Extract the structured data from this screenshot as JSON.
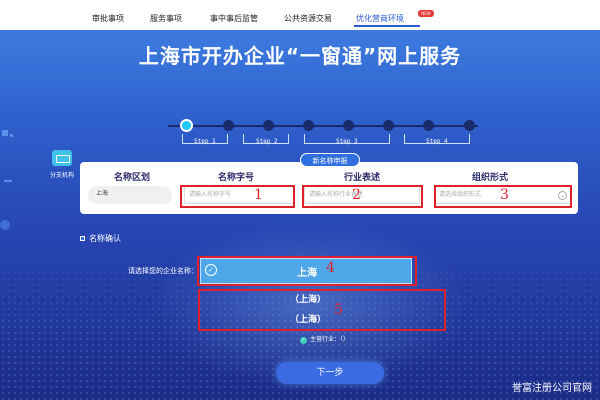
{
  "nav": {
    "items": [
      "审批事项",
      "服务事项",
      "事中事后监管",
      "公共资源交易",
      "优化营商环境"
    ],
    "active_index": 4,
    "badge": "NEW"
  },
  "title": "上海市开办企业“一窗通”网上服务",
  "stepper": {
    "steps": [
      "Step 1",
      "Step 2",
      "Step 3",
      "Step 4"
    ],
    "current_step": 1
  },
  "branch": {
    "label": "分支机构"
  },
  "form": {
    "tab_label": "新名称申报",
    "columns": {
      "region": "名称区划",
      "brand": "名称字号",
      "industry": "行业表述",
      "org_form": "组织形式"
    },
    "region_value": "上海",
    "brand_placeholder": "请输入名称字号",
    "industry_placeholder": "请输入名称行业表述",
    "org_placeholder": "请选择组织形式"
  },
  "annotations": [
    "1",
    "2",
    "3",
    "4",
    "5"
  ],
  "confirm": {
    "label": "名称确认"
  },
  "selection": {
    "prompt": "请选择您的企业名称：",
    "chosen": "上海",
    "options": [
      "（上海）",
      "（上海）"
    ],
    "industry_note": "主营行业：（）"
  },
  "next_button": "下一步",
  "watermark": "誉富注册公司官网",
  "colors": {
    "accent": "#2f6fe0",
    "annotation_red": "#e0202b"
  }
}
